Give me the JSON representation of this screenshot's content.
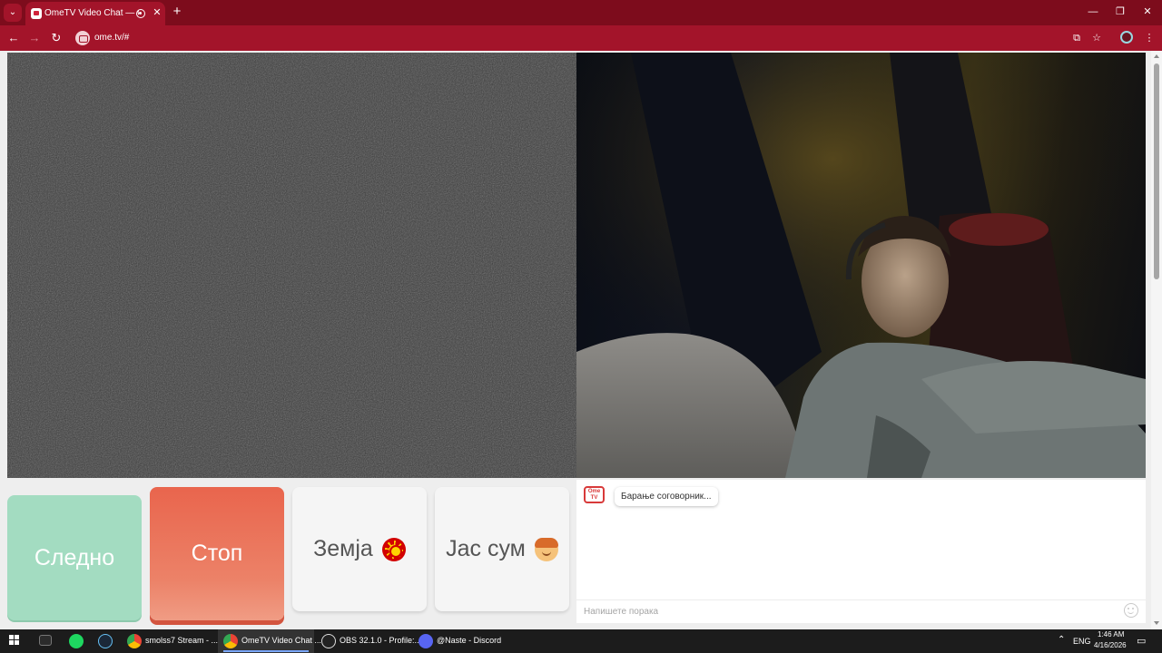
{
  "browser": {
    "tab_title": "OmeTV Video Chat — Ome",
    "url": "ome.tv/#",
    "window_buttons": {
      "minimize": "—",
      "maximize": "❐",
      "close": "✕"
    }
  },
  "page": {
    "buttons": {
      "next": "Следно",
      "stop": "Стоп",
      "country": "Земја",
      "gender": "Јас сум"
    },
    "chat": {
      "logo_text": "Ome TV",
      "status_message": "Барање соговорник...",
      "input_placeholder": "Напишете порака"
    }
  },
  "taskbar": {
    "apps": [
      {
        "label": "",
        "icon": "terminal-icon"
      },
      {
        "label": "",
        "icon": "spotify-icon"
      },
      {
        "label": "",
        "icon": "steam-icon"
      },
      {
        "label": "smolss7 Stream - ...",
        "icon": "chrome-icon"
      },
      {
        "label": "OmeTV Video Chat ...",
        "icon": "chrome-icon"
      },
      {
        "label": "OBS 32.1.0 - Profile:...",
        "icon": "obs-icon"
      },
      {
        "label": "@Naste - Discord",
        "icon": "discord-icon"
      }
    ],
    "tray": {
      "language": "ENG",
      "time": "1:46 AM",
      "date": "4/16/2026"
    }
  },
  "colors": {
    "browser_titlebar": "#7d0c1c",
    "browser_toolbar": "#a3142a",
    "next_button": "#a3dcc1",
    "stop_button": "#e9654d"
  }
}
